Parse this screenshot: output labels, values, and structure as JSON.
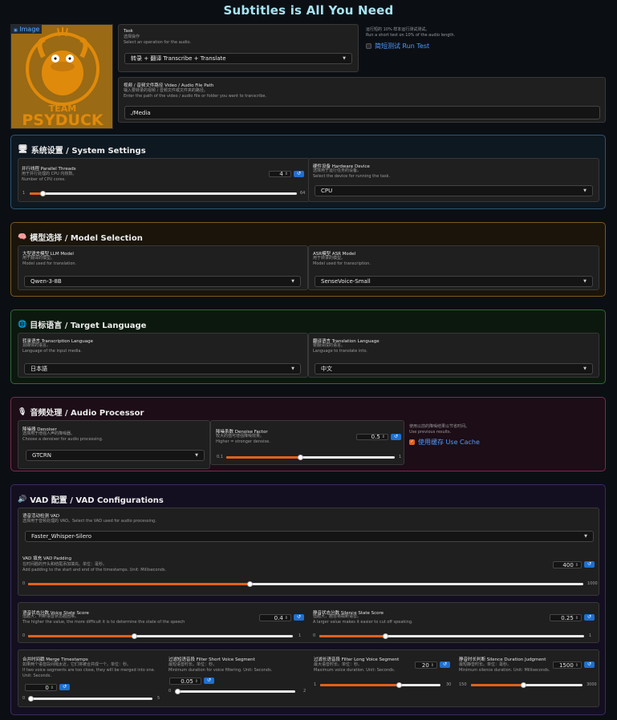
{
  "app": {
    "title": "Subtitles is All You Need"
  },
  "image": {
    "label": "Image",
    "team_line1": "TEAM",
    "team_line2": "PSYDUCK"
  },
  "task": {
    "label": "Task",
    "desc1": "选择操作",
    "desc2": "Select an operation for the audio.",
    "value": "转录 + 翻译 Transcribe + Translate",
    "test_desc1": "运行短的 10% 样本运行测试测试。",
    "test_desc2": "Run a short test on 10% of the audio length.",
    "test_label": "简短测试 Run Test"
  },
  "path": {
    "label": "视频 / 音频文件路径 Video / Audio File Path",
    "desc1": "输入要转录的视频 / 音频文件或文件夹的路径。",
    "desc2": "Enter the path of the video / audio file or folder you want to transcribe.",
    "value": "./Media"
  },
  "system": {
    "title": "系统设置 / System Settings",
    "threads_label": "并行线程 Parallel Threads",
    "threads_desc1": "用于并行处理的 CPU 内核数。",
    "threads_desc2": "Number of CPU cores.",
    "threads_value": "4",
    "threads_min": "1",
    "threads_max": "64",
    "threads_fraction": 0.05,
    "device_label": "硬件设备 Hardware Device",
    "device_desc1": "选择用于运行任务的设备。",
    "device_desc2": "Select the device for running the task.",
    "device_value": "CPU"
  },
  "model": {
    "title": "模型选择 / Model Selection",
    "llm_label": "大型语言模型 LLM Model",
    "llm_desc1": "用于翻译的模型。",
    "llm_desc2": "Model used for translation.",
    "llm_value": "Qwen-3-8B",
    "asr_label": "ASR模型 ASR Model",
    "asr_desc1": "用于转录的模型。",
    "asr_desc2": "Model used for transcription.",
    "asr_value": "SenseVoice-Small"
  },
  "language": {
    "title": "目标语言 / Target Language",
    "trans_label": "转录语言 Transcription Language",
    "trans_desc1": "源媒体的语言。",
    "trans_desc2": "Language of the input media.",
    "trans_value": "日本語",
    "translate_label": "翻译语言 Translation Language",
    "translate_desc1": "要翻译成的语言。",
    "translate_desc2": "Language to translate into.",
    "translate_value": "中文"
  },
  "audio": {
    "title": "音频处理 / Audio Processor",
    "denoiser_label": "降噪器 Denoiser",
    "denoiser_desc1": "选择用于增强人声的降噪器。",
    "denoiser_desc2": "Choose a denoiser for audio processing.",
    "denoiser_value": "GTCRN",
    "factor_label": "降噪系数 Denoise Factor",
    "factor_desc1": "较大的值可增强降噪效果。",
    "factor_desc2": "Higher = stronger denoise.",
    "factor_value": "0.5",
    "factor_min": "0.1",
    "factor_max": "1",
    "factor_fraction": 0.44,
    "cache_desc1": "使用以前的降噪结果以节省时间。",
    "cache_desc2": "Use previous results.",
    "cache_label": "使用缓存 Use Cache"
  },
  "vad": {
    "title": "VAD 配置 / VAD Configurations",
    "vad_label": "语音活动检测 VAD",
    "vad_desc": "选择用于音频处理的 VAD。Select the VAD used for audio processing.",
    "vad_value": "Faster_Whisper-Silero",
    "pad_label": "VAD 填充 VAD Padding",
    "pad_desc1": "在时间戳的开头和结尾添加填充。单位：毫秒。",
    "pad_desc2": "Add padding to the start and end of the timestamps. Unit: Milliseconds.",
    "pad_value": "400",
    "pad_min": "0",
    "pad_max": "1000",
    "pad_fraction": 0.4,
    "voice_label": "语音状态分数 Voice State Score",
    "voice_desc1": "值越大，判断语音状态越困难。",
    "voice_desc2": "The higher the value, the more difficult it is to determine the state of the speech",
    "voice_value": "0.4",
    "voice_min": "0",
    "voice_max": "1",
    "voice_fraction": 0.4,
    "silence_label": "静音状态分数 Silence State Score",
    "silence_desc1": "值越大，越容易截断语音。",
    "silence_desc2": "A larger value makes it easier to cut off speaking.",
    "silence_value": "0.25",
    "silence_min": "0",
    "silence_max": "1",
    "silence_fraction": 0.25,
    "merge_label": "合并时间戳 Merge Timestamps",
    "merge_desc1": "如果两个语音段间隔太近，它们将被合并成一个。单位：秒。",
    "merge_desc2": "If two voice segments are too close, they will be merged into one. Unit: Seconds.",
    "merge_value": "0",
    "merge_min": "0",
    "merge_max": "5",
    "merge_fraction": 0.0,
    "short_label": "过滤短语音段 Filter Short Voice Segment",
    "short_desc1": "最短语音时长。单位：秒。",
    "short_desc2": "Minimum duration for voice filtering. Unit: Seconds.",
    "short_value": "0.05",
    "short_min": "0",
    "short_max": "2",
    "short_fraction": 0.025,
    "long_label": "过滤长语音段 Filter Long Voice Segment",
    "long_desc1": "最大语音时长。单位：秒。",
    "long_desc2": "Maximum voice duration. Unit: Seconds.",
    "long_value": "20",
    "long_min": "1",
    "long_max": "30",
    "long_fraction": 0.655,
    "silence_dur_label": "静音时长判断 Silence Duration Judgment",
    "silence_dur_desc1": "最短静音时长。单位：毫秒。",
    "silence_dur_desc2": "Minimum silence duration. Unit: Milliseconds.",
    "silence_dur_value": "1500",
    "silence_dur_min": "150",
    "silence_dur_max": "3000",
    "silence_dur_fraction": 0.474
  },
  "colors": {
    "system_border": "#2c5573",
    "system_bg": "#0e1820",
    "model_border": "#7a5a1e",
    "model_bg": "#1a140a",
    "language_border": "#2f6a33",
    "language_bg": "#0c180e",
    "audio_border": "#7a2c52",
    "audio_bg": "#1c0d16",
    "vad_border": "#3e2a5e",
    "vad_bg": "#140f20",
    "accent_orange": "#e2611b",
    "accent_blue": "#1e6fd1"
  }
}
